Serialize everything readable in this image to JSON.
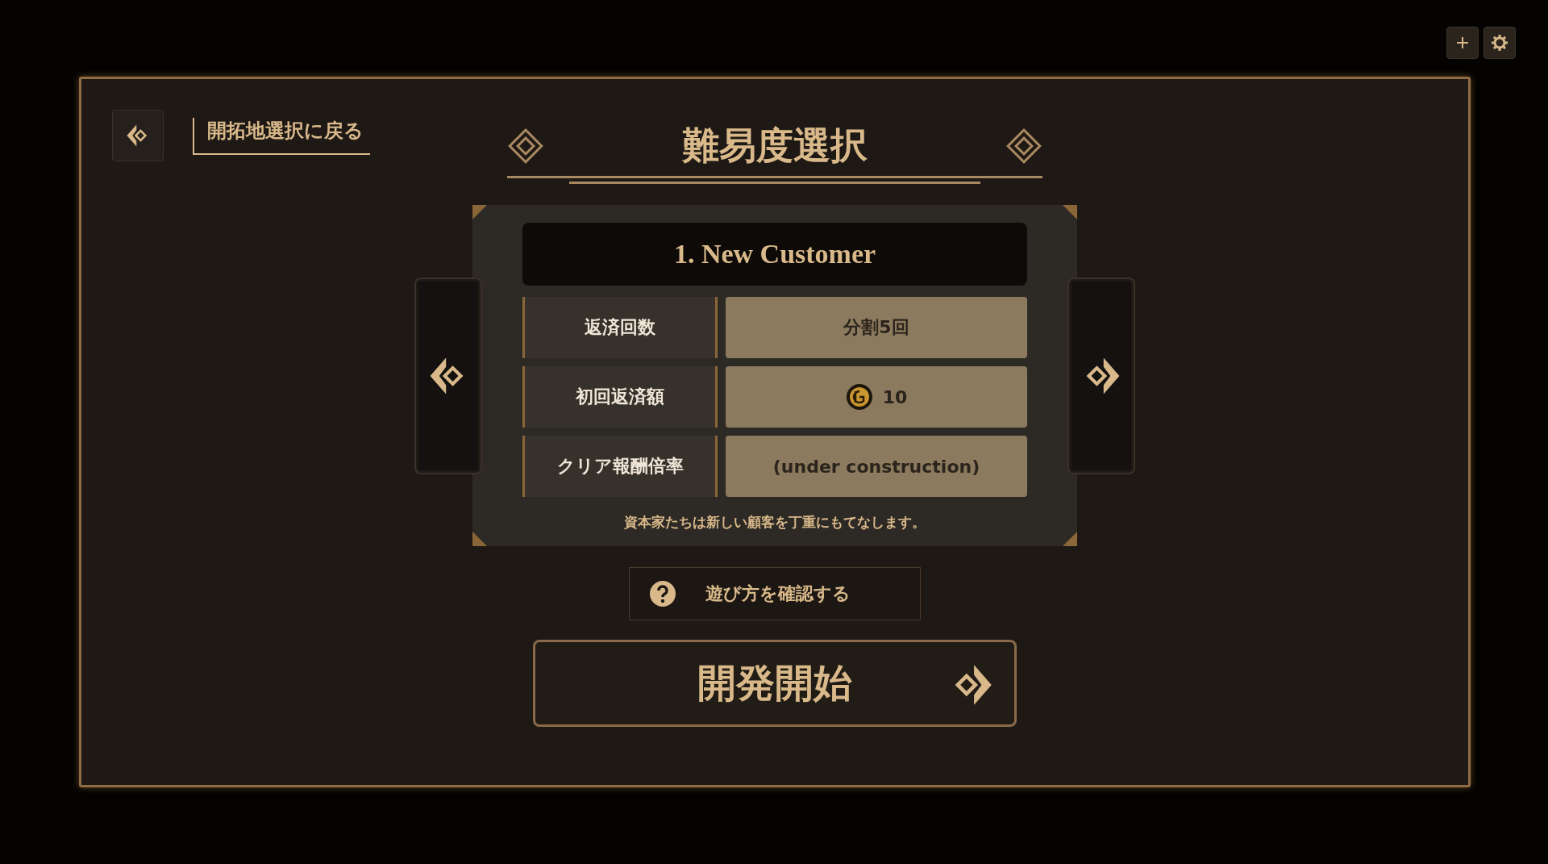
{
  "toolbar": {
    "buttons": [
      {
        "kind": "plus"
      },
      {
        "kind": "settings"
      }
    ]
  },
  "back": {
    "label": "開拓地選択に戻る"
  },
  "title": "難易度選択",
  "difficulty": {
    "name": "1. New Customer",
    "rows": [
      {
        "label": "返済回数",
        "value": "分割5回",
        "kind": "text"
      },
      {
        "label": "初回返済額",
        "value": "10",
        "kind": "coin"
      },
      {
        "label": "クリア報酬倍率",
        "value": "(under construction)",
        "kind": "text"
      }
    ],
    "description": "資本家たちは新しい顧客を丁重にもてなします。"
  },
  "help_button": "遊び方を確認する",
  "start_button": "開発開始"
}
